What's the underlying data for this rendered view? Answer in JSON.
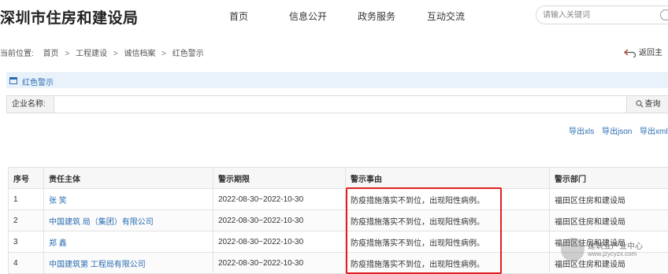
{
  "header": {
    "site_title": "深圳市住房和建设局",
    "nav": [
      "首页",
      "信息公开",
      "政务服务",
      "互动交流"
    ],
    "search_placeholder": "请输入关键词"
  },
  "breadcrumb": {
    "prefix": "当前位置:",
    "items": [
      "首页",
      "工程建设",
      "诚信档案",
      "红色警示"
    ],
    "separator": ">"
  },
  "back_link": "返回主",
  "section": {
    "title": "红色警示"
  },
  "filter": {
    "label": "企业名称:",
    "value": "",
    "query_button": "查询"
  },
  "exports": [
    "导出xls",
    "导出json",
    "导出xml"
  ],
  "table": {
    "columns": [
      "序号",
      "责任主体",
      "警示期限",
      "警示事由",
      "警示部门"
    ],
    "rows": [
      [
        "1",
        "张 笑",
        "2022-08-30~2022-10-30",
        "防疫措施落实不到位，出现阳性病例。",
        "福田区住房和建设局"
      ],
      [
        "2",
        "中国建筑 局（集团）有限公司",
        "2022-08-30~2022-10-30",
        "防疫措施落实不到位，出现阳性病例。",
        "福田区住房和建设局"
      ],
      [
        "3",
        "郑 鑫",
        "2022-08-30~2022-10-30",
        "防疫措施落实不到位，出现阳性病例。",
        "福田区住房和建设局"
      ],
      [
        "4",
        "中国建筑第 工程局有限公司",
        "2022-08-30~2022-10-30",
        "防疫措施落实不到位，出现阳性病例。",
        "福田区住房和建设局"
      ]
    ]
  },
  "watermark": {
    "name": "建筑业产业中心",
    "url": "www.jzycyzx.com"
  },
  "colors": {
    "link": "#2b6cb0",
    "highlight": "#e02020",
    "section_bg": "#e9f2fb"
  }
}
